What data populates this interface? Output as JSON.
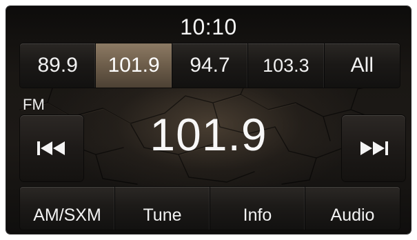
{
  "header": {
    "clock": "10:10"
  },
  "presets": [
    {
      "label": "89.9",
      "active": false
    },
    {
      "label": "101.9",
      "active": true
    },
    {
      "label": "94.7",
      "active": false
    },
    {
      "label": "103.3",
      "active": false
    },
    {
      "label": "All",
      "active": false
    }
  ],
  "tuner": {
    "band": "FM",
    "frequency": "101.9",
    "seek_back_icon": "seek-back-icon",
    "seek_forward_icon": "seek-forward-icon"
  },
  "bottom_bar": [
    {
      "label": "AM/SXM"
    },
    {
      "label": "Tune"
    },
    {
      "label": "Info"
    },
    {
      "label": "Audio"
    }
  ],
  "colors": {
    "active_preset": "#6d5d4a",
    "text": "#f2f2f2",
    "background": "#1a1714"
  }
}
